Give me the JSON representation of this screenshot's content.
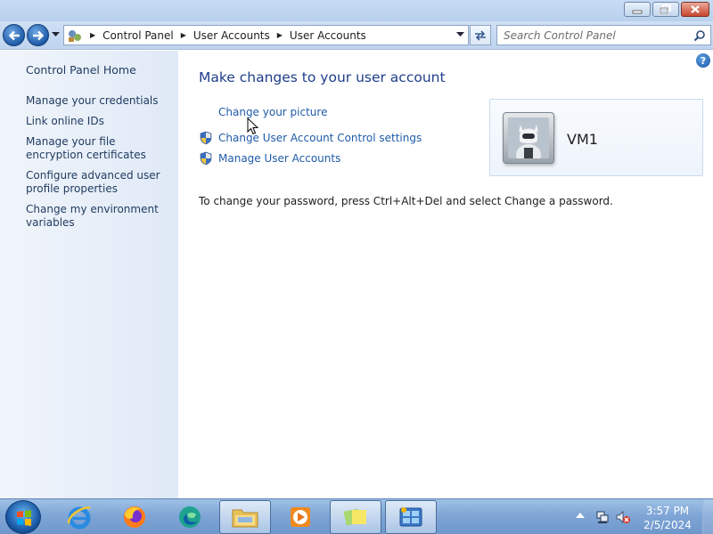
{
  "window": {
    "minimize_icon": "minimize-icon",
    "maximize_icon": "restore-icon",
    "close_icon": "close-icon"
  },
  "address_bar": {
    "breadcrumbs": [
      "Control Panel",
      "User Accounts",
      "User Accounts"
    ],
    "search_placeholder": "Search Control Panel"
  },
  "left_pane": {
    "home": "Control Panel Home",
    "tasks": [
      "Manage your credentials",
      "Link online IDs",
      "Manage your file encryption certificates",
      "Configure advanced user profile properties",
      "Change my environment variables"
    ]
  },
  "main": {
    "heading": "Make changes to your user account",
    "links": [
      "Change your picture",
      "Change User Account Control settings",
      "Manage User Accounts"
    ],
    "password_info": "To change your password, press Ctrl+Alt+Del and select Change a password.",
    "account_name": "VM1"
  },
  "taskbar": {
    "pinned": [
      "internet-explorer-icon",
      "firefox-icon",
      "edge-icon",
      "file-explorer-icon",
      "media-player-icon",
      "sticky-notes-icon",
      "control-panel-icon"
    ],
    "clock_time": "3:57 PM",
    "clock_date": "2/5/2024"
  },
  "colors": {
    "link": "#1f5ba8",
    "heading": "#1f3e8a",
    "left_pane_text": "#1e3a5f",
    "taskbar": "#7fa6d6"
  }
}
